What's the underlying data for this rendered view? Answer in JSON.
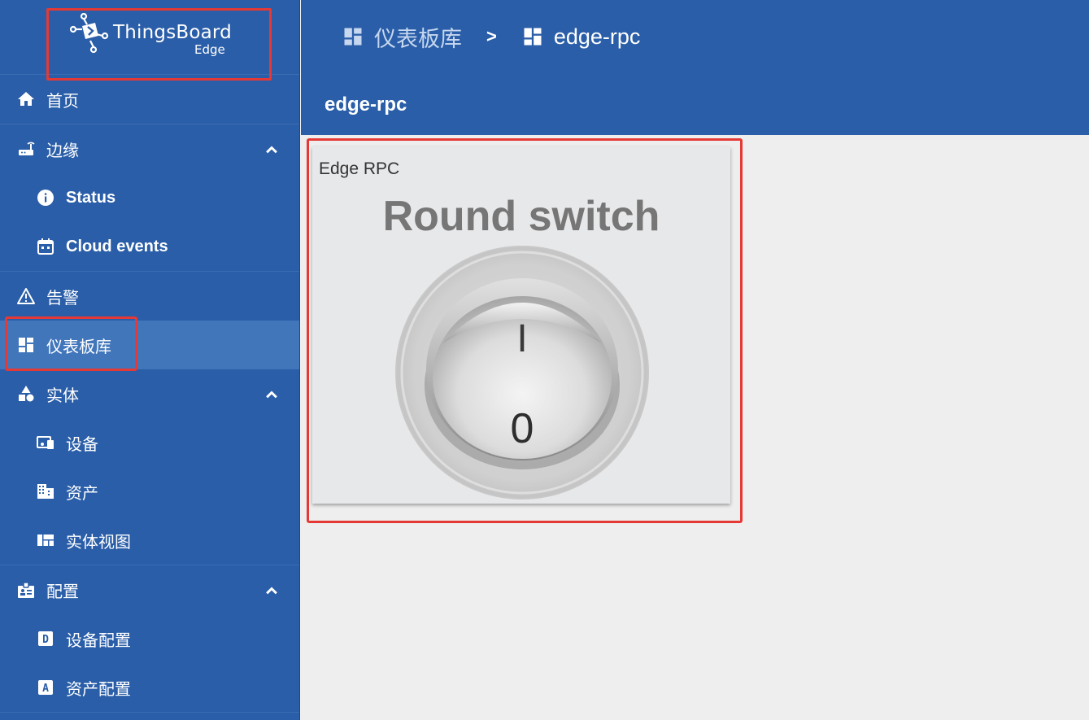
{
  "brand": {
    "title": "ThingsBoard",
    "subtitle": "Edge",
    "icon": "thingsboard-logo-icon"
  },
  "sidebar": {
    "items": [
      {
        "label": "首页",
        "icon": "home-icon"
      },
      {
        "label": "边缘",
        "icon": "router-icon",
        "expanded": true
      },
      {
        "label": "Status",
        "icon": "info-icon"
      },
      {
        "label": "Cloud events",
        "icon": "calendar-icon"
      },
      {
        "label": "告警",
        "icon": "warning-icon"
      },
      {
        "label": "仪表板库",
        "icon": "dashboard-icon",
        "active": true
      },
      {
        "label": "实体",
        "icon": "category-icon",
        "expanded": true
      },
      {
        "label": "设备",
        "icon": "devices-icon"
      },
      {
        "label": "资产",
        "icon": "domain-icon"
      },
      {
        "label": "实体视图",
        "icon": "view-quilt-icon"
      },
      {
        "label": "配置",
        "icon": "badge-icon",
        "expanded": true
      },
      {
        "label": "设备配置",
        "icon": "device-profile-icon"
      },
      {
        "label": "资产配置",
        "icon": "asset-profile-icon"
      }
    ]
  },
  "breadcrumb": {
    "items": [
      "仪表板库",
      "edge-rpc"
    ],
    "separator": ">"
  },
  "dashboard": {
    "title": "edge-rpc"
  },
  "widget": {
    "title": "Edge RPC",
    "label": "Round switch",
    "on_mark": "I",
    "off_mark": "0",
    "state": "off"
  },
  "colors": {
    "primary": "#2a5ea8",
    "active_item": "#4176bb",
    "highlight": "#e53935",
    "background": "#eeeeee"
  }
}
